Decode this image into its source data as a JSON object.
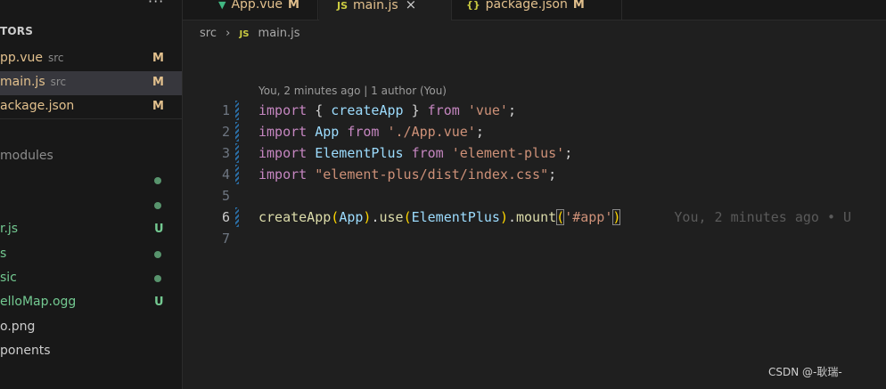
{
  "sidebar": {
    "more_icon": "ellipsis-icon",
    "section_title": "TORS",
    "open_editors": [
      {
        "name": "App.vue",
        "visible_name": "pp.vue",
        "dir": "src",
        "badge": "M"
      },
      {
        "name": "main.js",
        "visible_name": "main.js",
        "dir": "src",
        "badge": "M",
        "active": true
      },
      {
        "name": "package.json",
        "visible_name": "ackage.json",
        "dir": "",
        "badge": "M"
      }
    ],
    "tree": [
      {
        "label": "modules",
        "color": "#8c8c8c",
        "status": ""
      },
      {
        "label": "",
        "color": "#73c991",
        "status": "dot"
      },
      {
        "label": "",
        "color": "#73c991",
        "status": "dot"
      },
      {
        "label": "r.js",
        "color": "#73c991",
        "status": "U"
      },
      {
        "label": "s",
        "color": "#73c991",
        "status": "dot"
      },
      {
        "label": "sic",
        "color": "#73c991",
        "status": "dot"
      },
      {
        "label": "elloMap.ogg",
        "color": "#73c991",
        "status": "U"
      },
      {
        "label": "o.png",
        "color": "#cccccc",
        "status": ""
      },
      {
        "label": "ponents",
        "color": "#cccccc",
        "status": ""
      }
    ],
    "colors": {
      "modified": "#e2c08d",
      "untracked": "#73c991"
    }
  },
  "tabs": [
    {
      "label": "App.vue",
      "icon": "vue-icon",
      "icon_glyph": "▼",
      "icon_color": "#41b883",
      "badge": "M",
      "label_color": "#e2c08d"
    },
    {
      "label": "main.js",
      "icon": "js-icon",
      "icon_glyph": "JS",
      "icon_color": "#cbcb41",
      "badge": "",
      "label_color": "#e2c08d",
      "active": true,
      "close": "×"
    },
    {
      "label": "package.json",
      "icon": "json-icon",
      "icon_glyph": "{}",
      "icon_color": "#cbcb41",
      "badge": "M",
      "label_color": "#e2c08d"
    }
  ],
  "breadcrumb": {
    "folder": "src",
    "separator": "›",
    "file_icon": "JS",
    "file": "main.js"
  },
  "codelens": "You, 2 minutes ago | 1 author (You)",
  "code": {
    "lines": [
      {
        "n": "1",
        "tokens": [
          [
            "kw",
            "import"
          ],
          [
            "punc",
            " { "
          ],
          [
            "var",
            "createApp"
          ],
          [
            "punc",
            " } "
          ],
          [
            "kw",
            "from"
          ],
          [
            "punc",
            " "
          ],
          [
            "str",
            "'vue'"
          ],
          [
            "punc",
            ";"
          ]
        ],
        "mark": true
      },
      {
        "n": "2",
        "tokens": [
          [
            "kw",
            "import"
          ],
          [
            "punc",
            " "
          ],
          [
            "var",
            "App"
          ],
          [
            "punc",
            " "
          ],
          [
            "kw",
            "from"
          ],
          [
            "punc",
            " "
          ],
          [
            "str",
            "'./App.vue'"
          ],
          [
            "punc",
            ";"
          ]
        ],
        "mark": true
      },
      {
        "n": "3",
        "tokens": [
          [
            "kw",
            "import"
          ],
          [
            "punc",
            " "
          ],
          [
            "var",
            "ElementPlus"
          ],
          [
            "punc",
            " "
          ],
          [
            "kw",
            "from"
          ],
          [
            "punc",
            " "
          ],
          [
            "str",
            "'element-plus'"
          ],
          [
            "punc",
            ";"
          ]
        ],
        "mark": true
      },
      {
        "n": "4",
        "tokens": [
          [
            "kw",
            "import"
          ],
          [
            "punc",
            " "
          ],
          [
            "str",
            "\"element-plus/dist/index.css\""
          ],
          [
            "punc",
            ";"
          ]
        ],
        "mark": true
      },
      {
        "n": "5",
        "tokens": [],
        "mark": false
      },
      {
        "n": "6",
        "tokens": [
          [
            "fn",
            "createApp"
          ],
          [
            "b1",
            "("
          ],
          [
            "var",
            "App"
          ],
          [
            "b1",
            ")"
          ],
          [
            "punc",
            "."
          ],
          [
            "fn",
            "use"
          ],
          [
            "b1",
            "("
          ],
          [
            "var",
            "ElementPlus"
          ],
          [
            "b1",
            ")"
          ],
          [
            "punc",
            "."
          ],
          [
            "fn",
            "mount"
          ],
          [
            "b1box",
            "("
          ],
          [
            "str",
            "'#app'"
          ],
          [
            "b1box",
            ")"
          ]
        ],
        "mark": true,
        "current": true,
        "blame": "You, 2 minutes ago • U"
      },
      {
        "n": "7",
        "tokens": [],
        "mark": false
      }
    ]
  },
  "watermark": "CSDN @-耿瑞-"
}
